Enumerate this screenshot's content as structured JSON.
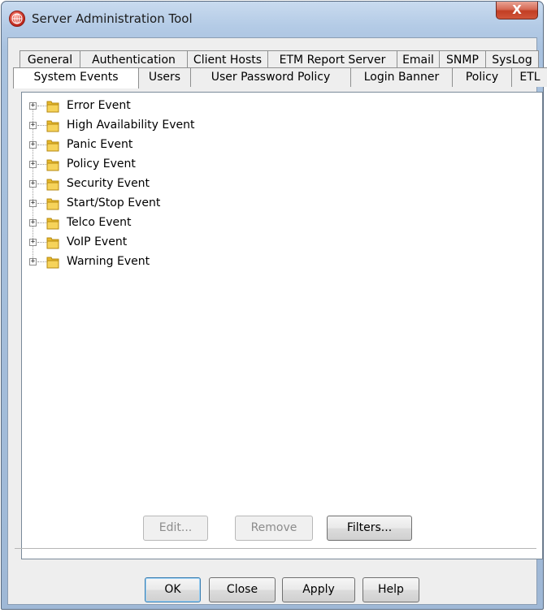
{
  "window": {
    "title": "Server Administration Tool",
    "close_label": "X"
  },
  "tabs": {
    "row1": [
      "General",
      "Authentication",
      "Client Hosts",
      "ETM Report Server",
      "Email",
      "SNMP",
      "SysLog"
    ],
    "row2": [
      "System Events",
      "Users",
      "User Password Policy",
      "Login Banner",
      "Policy",
      "ETL"
    ],
    "selected": "System Events"
  },
  "tree": {
    "items": [
      {
        "label": "Error Event"
      },
      {
        "label": "High Availability Event"
      },
      {
        "label": "Panic Event"
      },
      {
        "label": "Policy Event"
      },
      {
        "label": "Security Event"
      },
      {
        "label": "Start/Stop Event"
      },
      {
        "label": "Telco Event"
      },
      {
        "label": "VoIP Event"
      },
      {
        "label": "Warning Event"
      }
    ],
    "expander_glyph": "+"
  },
  "panel_buttons": {
    "edit": "Edit...",
    "remove": "Remove",
    "filters": "Filters..."
  },
  "dialog_buttons": {
    "ok": "OK",
    "close": "Close",
    "apply": "Apply",
    "help": "Help"
  },
  "colors": {
    "folder": "#e8b92c",
    "title_bar": "#b4cbe6",
    "close_button": "#c23e24",
    "default_button_border": "#3c7fb1"
  }
}
